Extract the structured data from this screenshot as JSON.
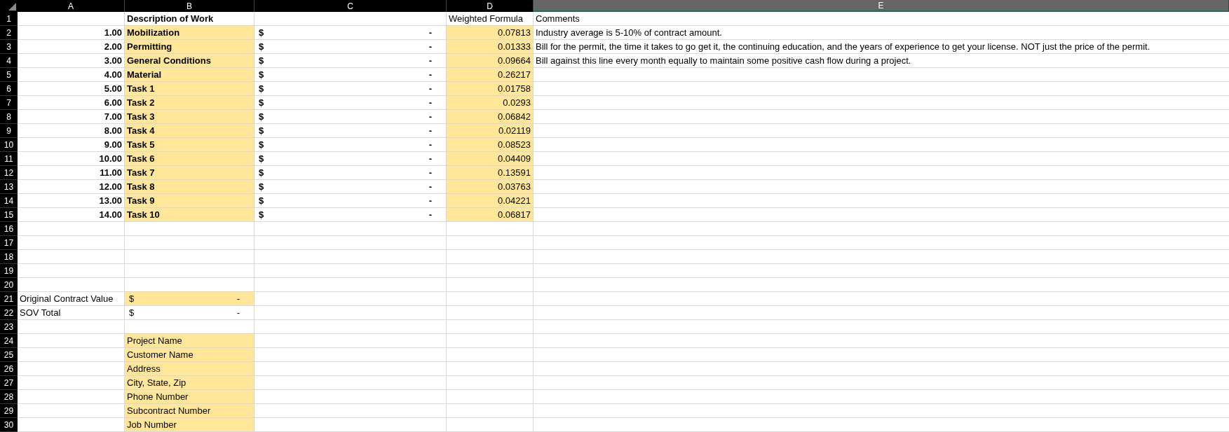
{
  "columns": [
    {
      "label": "A",
      "selected": false
    },
    {
      "label": "B",
      "selected": false
    },
    {
      "label": "C",
      "selected": false
    },
    {
      "label": "D",
      "selected": false
    },
    {
      "label": "E",
      "selected": true
    }
  ],
  "rows": [
    {
      "number": "1",
      "cells": [
        {
          "highlighted": false
        },
        {
          "kind": "text",
          "text": "Description of Work",
          "bold": true,
          "highlighted": false
        },
        {
          "highlighted": false
        },
        {
          "kind": "text",
          "text": "Weighted Formula",
          "highlighted": false
        },
        {
          "kind": "text",
          "text": "Comments",
          "highlighted": false
        }
      ]
    },
    {
      "number": "2",
      "cells": [
        {
          "kind": "number",
          "text": "1.00",
          "bold": true,
          "highlighted": false
        },
        {
          "kind": "text",
          "text": "Mobilization",
          "bold": true,
          "highlighted": true
        },
        {
          "kind": "currency",
          "symbol": "$",
          "text": "-",
          "bold": true,
          "highlighted": false
        },
        {
          "kind": "number",
          "text": "0.07813",
          "highlighted": true
        },
        {
          "kind": "text",
          "text": "Industry average is 5-10% of contract amount.",
          "highlighted": false
        }
      ]
    },
    {
      "number": "3",
      "cells": [
        {
          "kind": "number",
          "text": "2.00",
          "bold": true,
          "highlighted": false
        },
        {
          "kind": "text",
          "text": "Permitting",
          "bold": true,
          "highlighted": true
        },
        {
          "kind": "currency",
          "symbol": "$",
          "text": "-",
          "bold": true,
          "highlighted": false
        },
        {
          "kind": "number",
          "text": "0.01333",
          "highlighted": true
        },
        {
          "kind": "text",
          "text": "Bill for the permit, the time it takes to go get it, the continuing education, and the years of experience to get your license. NOT just the price of the permit.",
          "highlighted": false
        }
      ]
    },
    {
      "number": "4",
      "cells": [
        {
          "kind": "number",
          "text": "3.00",
          "bold": true,
          "highlighted": false
        },
        {
          "kind": "text",
          "text": "General Conditions",
          "bold": true,
          "highlighted": true
        },
        {
          "kind": "currency",
          "symbol": "$",
          "text": "-",
          "bold": true,
          "highlighted": false
        },
        {
          "kind": "number",
          "text": "0.09664",
          "highlighted": true
        },
        {
          "kind": "text",
          "text": "Bill against this line every month equally to maintain some positive cash flow during a project.",
          "highlighted": false
        }
      ]
    },
    {
      "number": "5",
      "cells": [
        {
          "kind": "number",
          "text": "4.00",
          "bold": true,
          "highlighted": false
        },
        {
          "kind": "text",
          "text": "Material",
          "bold": true,
          "highlighted": true
        },
        {
          "kind": "currency",
          "symbol": "$",
          "text": "-",
          "bold": true,
          "highlighted": false
        },
        {
          "kind": "number",
          "text": "0.26217",
          "highlighted": true
        },
        {
          "highlighted": false
        }
      ]
    },
    {
      "number": "6",
      "cells": [
        {
          "kind": "number",
          "text": "5.00",
          "bold": true,
          "highlighted": false
        },
        {
          "kind": "text",
          "text": "Task 1",
          "bold": true,
          "highlighted": true
        },
        {
          "kind": "currency",
          "symbol": "$",
          "text": "-",
          "bold": true,
          "highlighted": false
        },
        {
          "kind": "number",
          "text": "0.01758",
          "highlighted": true
        },
        {
          "highlighted": false
        }
      ]
    },
    {
      "number": "7",
      "cells": [
        {
          "kind": "number",
          "text": "6.00",
          "bold": true,
          "highlighted": false
        },
        {
          "kind": "text",
          "text": "Task 2",
          "bold": true,
          "highlighted": true
        },
        {
          "kind": "currency",
          "symbol": "$",
          "text": "-",
          "bold": true,
          "highlighted": false
        },
        {
          "kind": "number",
          "text": "0.0293",
          "highlighted": true
        },
        {
          "highlighted": false
        }
      ]
    },
    {
      "number": "8",
      "cells": [
        {
          "kind": "number",
          "text": "7.00",
          "bold": true,
          "highlighted": false
        },
        {
          "kind": "text",
          "text": "Task 3",
          "bold": true,
          "highlighted": true
        },
        {
          "kind": "currency",
          "symbol": "$",
          "text": "-",
          "bold": true,
          "highlighted": false
        },
        {
          "kind": "number",
          "text": "0.06842",
          "highlighted": true
        },
        {
          "highlighted": false
        }
      ]
    },
    {
      "number": "9",
      "cells": [
        {
          "kind": "number",
          "text": "8.00",
          "bold": true,
          "highlighted": false
        },
        {
          "kind": "text",
          "text": "Task 4",
          "bold": true,
          "highlighted": true
        },
        {
          "kind": "currency",
          "symbol": "$",
          "text": "-",
          "bold": true,
          "highlighted": false
        },
        {
          "kind": "number",
          "text": "0.02119",
          "highlighted": true
        },
        {
          "highlighted": false
        }
      ]
    },
    {
      "number": "10",
      "cells": [
        {
          "kind": "number",
          "text": "9.00",
          "bold": true,
          "highlighted": false
        },
        {
          "kind": "text",
          "text": "Task 5",
          "bold": true,
          "highlighted": true
        },
        {
          "kind": "currency",
          "symbol": "$",
          "text": "-",
          "bold": true,
          "highlighted": false
        },
        {
          "kind": "number",
          "text": "0.08523",
          "highlighted": true
        },
        {
          "highlighted": false
        }
      ]
    },
    {
      "number": "11",
      "cells": [
        {
          "kind": "number",
          "text": "10.00",
          "bold": true,
          "highlighted": false
        },
        {
          "kind": "text",
          "text": "Task 6",
          "bold": true,
          "highlighted": true
        },
        {
          "kind": "currency",
          "symbol": "$",
          "text": "-",
          "bold": true,
          "highlighted": false
        },
        {
          "kind": "number",
          "text": "0.04409",
          "highlighted": true
        },
        {
          "highlighted": false
        }
      ]
    },
    {
      "number": "12",
      "cells": [
        {
          "kind": "number",
          "text": "11.00",
          "bold": true,
          "highlighted": false
        },
        {
          "kind": "text",
          "text": "Task 7",
          "bold": true,
          "highlighted": true
        },
        {
          "kind": "currency",
          "symbol": "$",
          "text": "-",
          "bold": true,
          "highlighted": false
        },
        {
          "kind": "number",
          "text": "0.13591",
          "highlighted": true
        },
        {
          "highlighted": false
        }
      ]
    },
    {
      "number": "13",
      "cells": [
        {
          "kind": "number",
          "text": "12.00",
          "bold": true,
          "highlighted": false
        },
        {
          "kind": "text",
          "text": "Task 8",
          "bold": true,
          "highlighted": true
        },
        {
          "kind": "currency",
          "symbol": "$",
          "text": "-",
          "bold": true,
          "highlighted": false
        },
        {
          "kind": "number",
          "text": "0.03763",
          "highlighted": true
        },
        {
          "highlighted": false
        }
      ]
    },
    {
      "number": "14",
      "cells": [
        {
          "kind": "number",
          "text": "13.00",
          "bold": true,
          "highlighted": false
        },
        {
          "kind": "text",
          "text": "Task 9",
          "bold": true,
          "highlighted": true
        },
        {
          "kind": "currency",
          "symbol": "$",
          "text": "-",
          "bold": true,
          "highlighted": false
        },
        {
          "kind": "number",
          "text": "0.04221",
          "highlighted": true
        },
        {
          "highlighted": false
        }
      ]
    },
    {
      "number": "15",
      "cells": [
        {
          "kind": "number",
          "text": "14.00",
          "bold": true,
          "highlighted": false
        },
        {
          "kind": "text",
          "text": "Task 10",
          "bold": true,
          "highlighted": true
        },
        {
          "kind": "currency",
          "symbol": "$",
          "text": "-",
          "bold": true,
          "highlighted": false
        },
        {
          "kind": "number",
          "text": "0.06817",
          "highlighted": true
        },
        {
          "highlighted": false
        }
      ]
    },
    {
      "number": "16",
      "cells": [
        {
          "highlighted": false
        },
        {
          "highlighted": false
        },
        {
          "highlighted": false
        },
        {
          "highlighted": false
        },
        {
          "highlighted": false
        }
      ]
    },
    {
      "number": "17",
      "cells": [
        {
          "highlighted": false
        },
        {
          "highlighted": false
        },
        {
          "highlighted": false
        },
        {
          "highlighted": false
        },
        {
          "highlighted": false
        }
      ]
    },
    {
      "number": "18",
      "cells": [
        {
          "highlighted": false
        },
        {
          "highlighted": false
        },
        {
          "highlighted": false
        },
        {
          "highlighted": false
        },
        {
          "highlighted": false
        }
      ]
    },
    {
      "number": "19",
      "cells": [
        {
          "highlighted": false
        },
        {
          "highlighted": false
        },
        {
          "highlighted": false
        },
        {
          "highlighted": false
        },
        {
          "highlighted": false
        }
      ]
    },
    {
      "number": "20",
      "cells": [
        {
          "highlighted": false
        },
        {
          "highlighted": false
        },
        {
          "highlighted": false
        },
        {
          "highlighted": false
        },
        {
          "highlighted": false
        }
      ]
    },
    {
      "number": "21",
      "cells": [
        {
          "kind": "text",
          "text": "Original Contract Value",
          "highlighted": false
        },
        {
          "kind": "currency",
          "symbol": "$",
          "text": "-",
          "highlighted": true
        },
        {
          "highlighted": false
        },
        {
          "highlighted": false
        },
        {
          "highlighted": false
        }
      ]
    },
    {
      "number": "22",
      "cells": [
        {
          "kind": "text",
          "text": "SOV Total",
          "highlighted": false
        },
        {
          "kind": "currency",
          "symbol": "$",
          "text": "-",
          "highlighted": false
        },
        {
          "highlighted": false
        },
        {
          "highlighted": false
        },
        {
          "highlighted": false
        }
      ]
    },
    {
      "number": "23",
      "cells": [
        {
          "highlighted": false
        },
        {
          "highlighted": false
        },
        {
          "highlighted": false
        },
        {
          "highlighted": false
        },
        {
          "highlighted": false
        }
      ]
    },
    {
      "number": "24",
      "cells": [
        {
          "highlighted": false
        },
        {
          "kind": "text",
          "text": "Project Name",
          "highlighted": true
        },
        {
          "highlighted": false
        },
        {
          "highlighted": false
        },
        {
          "highlighted": false
        }
      ]
    },
    {
      "number": "25",
      "cells": [
        {
          "highlighted": false
        },
        {
          "kind": "text",
          "text": "Customer Name",
          "highlighted": true
        },
        {
          "highlighted": false
        },
        {
          "highlighted": false
        },
        {
          "highlighted": false
        }
      ]
    },
    {
      "number": "26",
      "cells": [
        {
          "highlighted": false
        },
        {
          "kind": "text",
          "text": "Address",
          "highlighted": true
        },
        {
          "highlighted": false
        },
        {
          "highlighted": false
        },
        {
          "highlighted": false
        }
      ]
    },
    {
      "number": "27",
      "cells": [
        {
          "highlighted": false
        },
        {
          "kind": "text",
          "text": "City, State, Zip",
          "highlighted": true
        },
        {
          "highlighted": false
        },
        {
          "highlighted": false
        },
        {
          "highlighted": false
        }
      ]
    },
    {
      "number": "28",
      "cells": [
        {
          "highlighted": false
        },
        {
          "kind": "text",
          "text": "Phone Number",
          "highlighted": true
        },
        {
          "highlighted": false
        },
        {
          "highlighted": false
        },
        {
          "highlighted": false
        }
      ]
    },
    {
      "number": "29",
      "cells": [
        {
          "highlighted": false
        },
        {
          "kind": "text",
          "text": "Subcontract Number",
          "highlighted": true
        },
        {
          "highlighted": false
        },
        {
          "highlighted": false
        },
        {
          "highlighted": false
        }
      ]
    },
    {
      "number": "30",
      "cells": [
        {
          "highlighted": false
        },
        {
          "kind": "text",
          "text": "Job Number",
          "highlighted": true
        },
        {
          "highlighted": false
        },
        {
          "highlighted": false
        },
        {
          "highlighted": false
        }
      ]
    }
  ]
}
